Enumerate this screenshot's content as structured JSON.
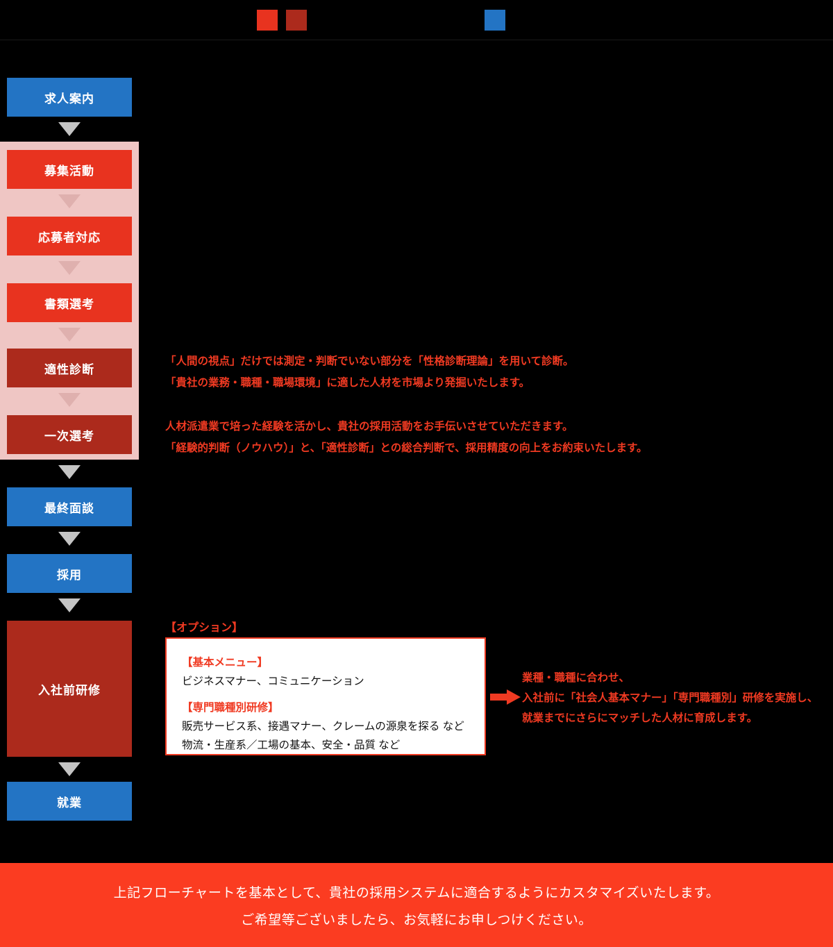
{
  "legend": {
    "items": [
      {
        "swatch_color": "#E8331F",
        "label": ""
      },
      {
        "swatch_color": "#AC2A1C",
        "label": ""
      },
      {
        "swatch_color": "#2374C4",
        "label": ""
      }
    ]
  },
  "flow": {
    "band_color": "#EFC6C4",
    "steps": [
      {
        "label": "求人案内",
        "color": "#2374C4"
      },
      {
        "label": "募集活動",
        "color": "#E8331F"
      },
      {
        "label": "応募者対応",
        "color": "#E8331F"
      },
      {
        "label": "書類選考",
        "color": "#E8331F"
      },
      {
        "label": "適性診断",
        "color": "#AC2A1C"
      },
      {
        "label": "一次選考",
        "color": "#AC2A1C"
      },
      {
        "label": "最終面談",
        "color": "#2374C4"
      },
      {
        "label": "採用",
        "color": "#2374C4"
      },
      {
        "label": "入社前研修",
        "color": "#AC2A1C"
      },
      {
        "label": "就業",
        "color": "#2374C4"
      }
    ]
  },
  "notes": {
    "shindan": "「人間の視点」だけでは測定・判断でいない部分を「性格診断理論」を用いて診断。\n「貴社の業務・職種・職場環境」に適した人材を市場より発掘いたします。",
    "senko": "人材派遣業で培った経験を活かし、貴社の採用活動をお手伝いさせていただきます。\n「経験的判断（ノウハウ）」と、「適性診断」との総合判断で、採用精度の向上をお約束いたします。"
  },
  "option": {
    "title": "【オプション】",
    "basic_head": "【基本メニュー】",
    "basic_body": "ビジネスマナー、コミュニケーション",
    "special_head": "【専門職種別研修】",
    "special_body": "販売サービス系、接遇マナー、クレームの源泉を探る など\n物流・生産系／工場の基本、安全・品質 など",
    "right_note": "業種・職種に合わせ、\n入社前に「社会人基本マナー」「専門職種別」研修を実施し、\n就業までにさらにマッチした人材に育成します。"
  },
  "banner": {
    "color": "#FB3C21",
    "line1": "上記フローチャートを基本として、貴社の採用システムに適合するようにカスタマイズいたします。",
    "line2": "ご希望等ございましたら、お気軽にお申しつけください。"
  }
}
